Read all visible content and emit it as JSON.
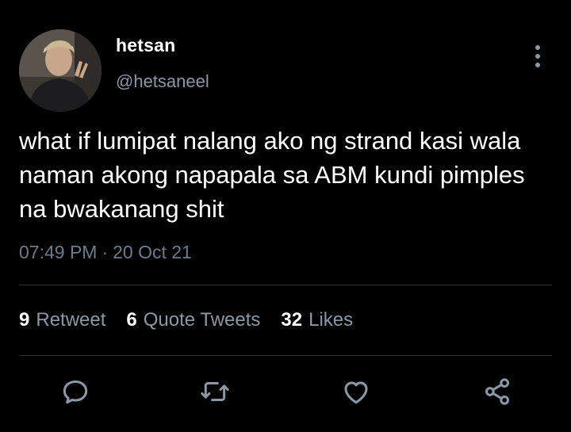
{
  "author": {
    "display_name": "hetsan",
    "handle": "@hetsaneel"
  },
  "tweet": {
    "text": "what if lumipat nalang ako ng strand kasi wala naman akong napapala sa ABM kundi pimples na bwakanang shit",
    "time": "07:49 PM",
    "separator": "·",
    "date": "20 Oct 21"
  },
  "stats": {
    "retweets_count": "9",
    "retweets_label": "Retweet",
    "quotes_count": "6",
    "quotes_label": "Quote Tweets",
    "likes_count": "32",
    "likes_label": "Likes"
  },
  "icons": {
    "more": "more-vertical-icon",
    "reply": "reply-icon",
    "retweet": "retweet-icon",
    "like": "heart-icon",
    "share": "share-icon"
  },
  "colors": {
    "background": "#000000",
    "primary_text": "#ffffff",
    "secondary_text": "#8b98a5",
    "divider": "#2f3336"
  }
}
